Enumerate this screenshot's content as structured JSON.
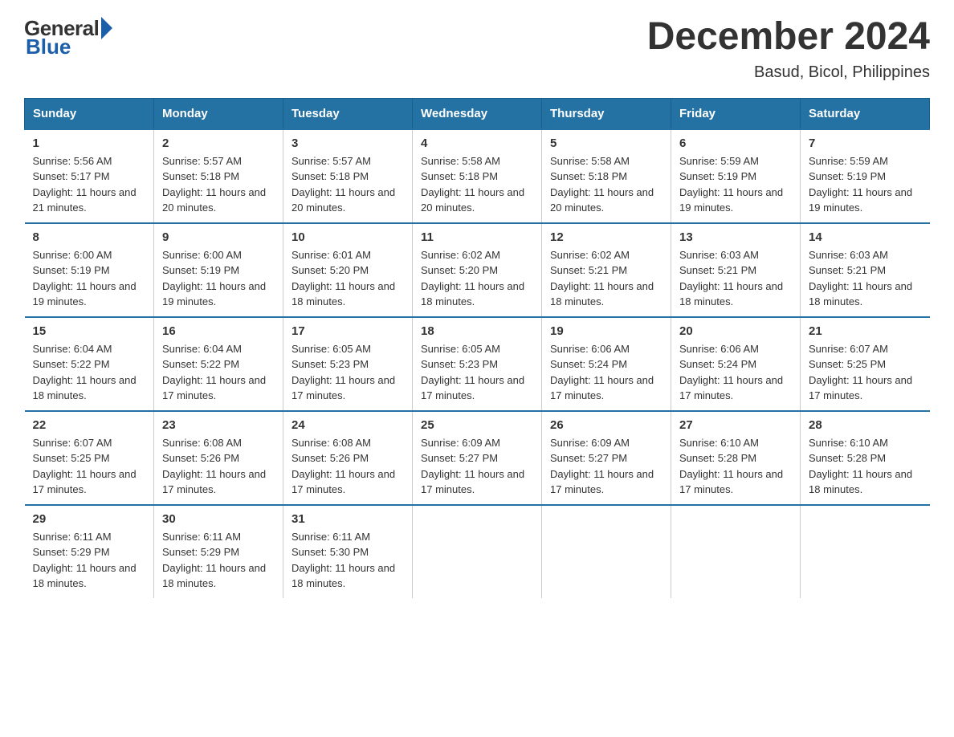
{
  "logo": {
    "general": "General",
    "blue": "Blue"
  },
  "title": "December 2024",
  "subtitle": "Basud, Bicol, Philippines",
  "headers": [
    "Sunday",
    "Monday",
    "Tuesday",
    "Wednesday",
    "Thursday",
    "Friday",
    "Saturday"
  ],
  "weeks": [
    [
      {
        "day": "1",
        "sunrise": "5:56 AM",
        "sunset": "5:17 PM",
        "daylight": "11 hours and 21 minutes."
      },
      {
        "day": "2",
        "sunrise": "5:57 AM",
        "sunset": "5:18 PM",
        "daylight": "11 hours and 20 minutes."
      },
      {
        "day": "3",
        "sunrise": "5:57 AM",
        "sunset": "5:18 PM",
        "daylight": "11 hours and 20 minutes."
      },
      {
        "day": "4",
        "sunrise": "5:58 AM",
        "sunset": "5:18 PM",
        "daylight": "11 hours and 20 minutes."
      },
      {
        "day": "5",
        "sunrise": "5:58 AM",
        "sunset": "5:18 PM",
        "daylight": "11 hours and 20 minutes."
      },
      {
        "day": "6",
        "sunrise": "5:59 AM",
        "sunset": "5:19 PM",
        "daylight": "11 hours and 19 minutes."
      },
      {
        "day": "7",
        "sunrise": "5:59 AM",
        "sunset": "5:19 PM",
        "daylight": "11 hours and 19 minutes."
      }
    ],
    [
      {
        "day": "8",
        "sunrise": "6:00 AM",
        "sunset": "5:19 PM",
        "daylight": "11 hours and 19 minutes."
      },
      {
        "day": "9",
        "sunrise": "6:00 AM",
        "sunset": "5:19 PM",
        "daylight": "11 hours and 19 minutes."
      },
      {
        "day": "10",
        "sunrise": "6:01 AM",
        "sunset": "5:20 PM",
        "daylight": "11 hours and 18 minutes."
      },
      {
        "day": "11",
        "sunrise": "6:02 AM",
        "sunset": "5:20 PM",
        "daylight": "11 hours and 18 minutes."
      },
      {
        "day": "12",
        "sunrise": "6:02 AM",
        "sunset": "5:21 PM",
        "daylight": "11 hours and 18 minutes."
      },
      {
        "day": "13",
        "sunrise": "6:03 AM",
        "sunset": "5:21 PM",
        "daylight": "11 hours and 18 minutes."
      },
      {
        "day": "14",
        "sunrise": "6:03 AM",
        "sunset": "5:21 PM",
        "daylight": "11 hours and 18 minutes."
      }
    ],
    [
      {
        "day": "15",
        "sunrise": "6:04 AM",
        "sunset": "5:22 PM",
        "daylight": "11 hours and 18 minutes."
      },
      {
        "day": "16",
        "sunrise": "6:04 AM",
        "sunset": "5:22 PM",
        "daylight": "11 hours and 17 minutes."
      },
      {
        "day": "17",
        "sunrise": "6:05 AM",
        "sunset": "5:23 PM",
        "daylight": "11 hours and 17 minutes."
      },
      {
        "day": "18",
        "sunrise": "6:05 AM",
        "sunset": "5:23 PM",
        "daylight": "11 hours and 17 minutes."
      },
      {
        "day": "19",
        "sunrise": "6:06 AM",
        "sunset": "5:24 PM",
        "daylight": "11 hours and 17 minutes."
      },
      {
        "day": "20",
        "sunrise": "6:06 AM",
        "sunset": "5:24 PM",
        "daylight": "11 hours and 17 minutes."
      },
      {
        "day": "21",
        "sunrise": "6:07 AM",
        "sunset": "5:25 PM",
        "daylight": "11 hours and 17 minutes."
      }
    ],
    [
      {
        "day": "22",
        "sunrise": "6:07 AM",
        "sunset": "5:25 PM",
        "daylight": "11 hours and 17 minutes."
      },
      {
        "day": "23",
        "sunrise": "6:08 AM",
        "sunset": "5:26 PM",
        "daylight": "11 hours and 17 minutes."
      },
      {
        "day": "24",
        "sunrise": "6:08 AM",
        "sunset": "5:26 PM",
        "daylight": "11 hours and 17 minutes."
      },
      {
        "day": "25",
        "sunrise": "6:09 AM",
        "sunset": "5:27 PM",
        "daylight": "11 hours and 17 minutes."
      },
      {
        "day": "26",
        "sunrise": "6:09 AM",
        "sunset": "5:27 PM",
        "daylight": "11 hours and 17 minutes."
      },
      {
        "day": "27",
        "sunrise": "6:10 AM",
        "sunset": "5:28 PM",
        "daylight": "11 hours and 17 minutes."
      },
      {
        "day": "28",
        "sunrise": "6:10 AM",
        "sunset": "5:28 PM",
        "daylight": "11 hours and 18 minutes."
      }
    ],
    [
      {
        "day": "29",
        "sunrise": "6:11 AM",
        "sunset": "5:29 PM",
        "daylight": "11 hours and 18 minutes."
      },
      {
        "day": "30",
        "sunrise": "6:11 AM",
        "sunset": "5:29 PM",
        "daylight": "11 hours and 18 minutes."
      },
      {
        "day": "31",
        "sunrise": "6:11 AM",
        "sunset": "5:30 PM",
        "daylight": "11 hours and 18 minutes."
      },
      {
        "day": "",
        "sunrise": "",
        "sunset": "",
        "daylight": ""
      },
      {
        "day": "",
        "sunrise": "",
        "sunset": "",
        "daylight": ""
      },
      {
        "day": "",
        "sunrise": "",
        "sunset": "",
        "daylight": ""
      },
      {
        "day": "",
        "sunrise": "",
        "sunset": "",
        "daylight": ""
      }
    ]
  ]
}
